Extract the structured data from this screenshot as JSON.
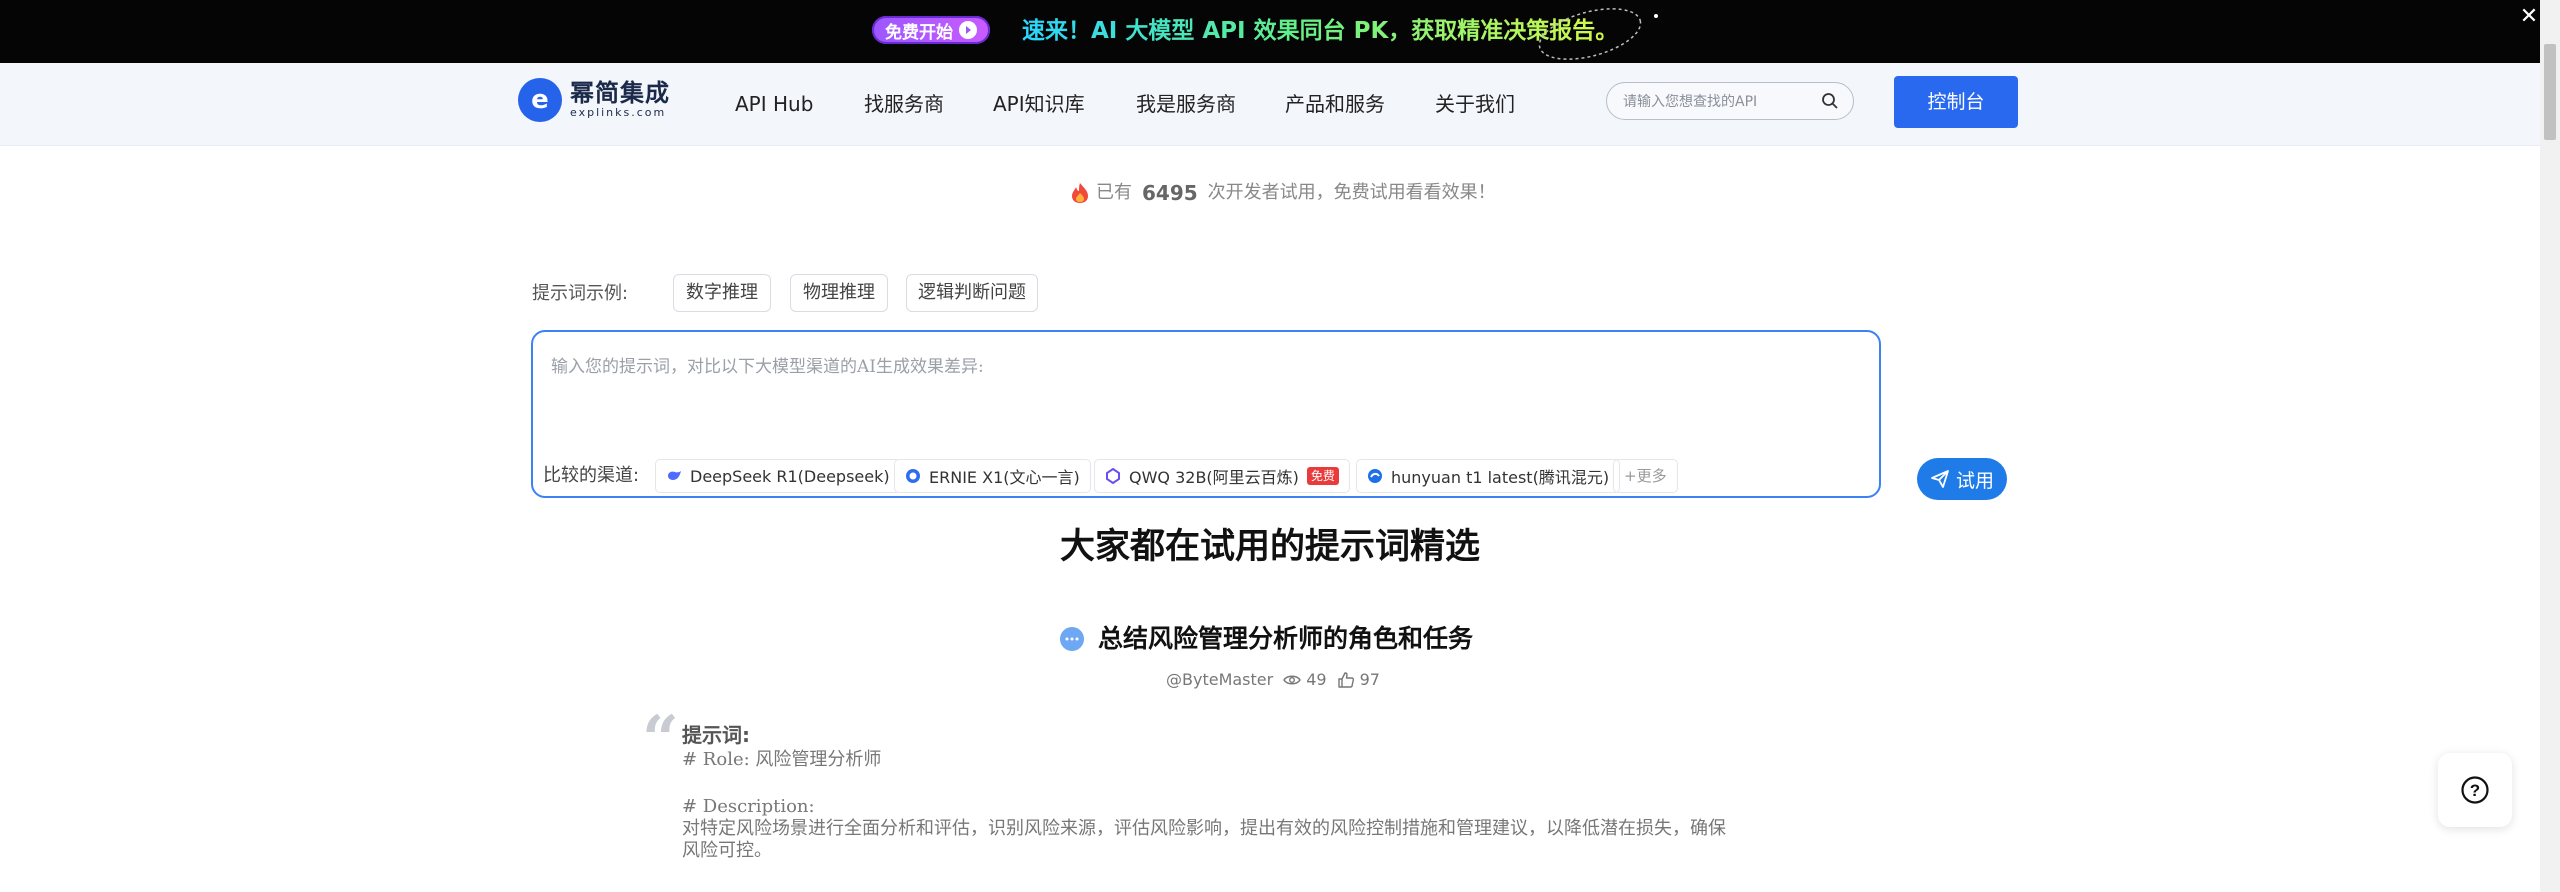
{
  "promo": {
    "badge_label": "免费开始",
    "text": "速来！AI 大模型 API 效果同台 PK，获取精准决策报告。",
    "close_label": "✕"
  },
  "header": {
    "logo_cn": "幂简集成",
    "logo_en": "explinks.com",
    "nav": [
      "API Hub",
      "找服务商",
      "API知识库",
      "我是服务商",
      "产品和服务",
      "关于我们"
    ],
    "search_placeholder": "请输入您想查找的API",
    "console_label": "控制台"
  },
  "trial": {
    "prefix": "已有",
    "count": "6495",
    "suffix": "次开发者试用，免费试用看看效果！"
  },
  "examples": {
    "label": "提示词示例:",
    "chips": [
      "数字推理",
      "物理推理",
      "逻辑判断问题"
    ]
  },
  "prompt": {
    "placeholder": "输入您的提示词，对比以下大模型渠道的AI生成效果差异:",
    "channels_label": "比较的渠道:",
    "channels": [
      {
        "name": "DeepSeek R1(Deepseek)",
        "icon": "deepseek-icon"
      },
      {
        "name": "ERNIE X1(文心一言)",
        "icon": "ernie-icon"
      },
      {
        "name": "QWQ 32B(阿里云百炼)",
        "icon": "qwen-icon",
        "tag": "免费"
      },
      {
        "name": "hunyuan t1 latest(腾讯混元)",
        "icon": "hunyuan-icon"
      }
    ],
    "more_label": "+更多",
    "try_label": "试用"
  },
  "section": {
    "title": "大家都在试用的提示词精选"
  },
  "card": {
    "title": "总结风险管理分析师的角色和任务",
    "author": "@ByteMaster",
    "views": "49",
    "likes": "97",
    "prompt_heading": "提示词:",
    "lines": [
      "# Role: 风险管理分析师",
      "",
      "# Description:",
      "对特定风险场景进行全面分析和评估，识别风险来源，评估风险影响，提出有效的风险控制措施和管理建议，以降低潜在损失，确保",
      "风险可控。"
    ]
  },
  "help": {
    "label": "?"
  },
  "colors": {
    "brand_blue": "#2869f0",
    "panel_border": "#3b82f6",
    "free_tag": "#e93b3b"
  }
}
